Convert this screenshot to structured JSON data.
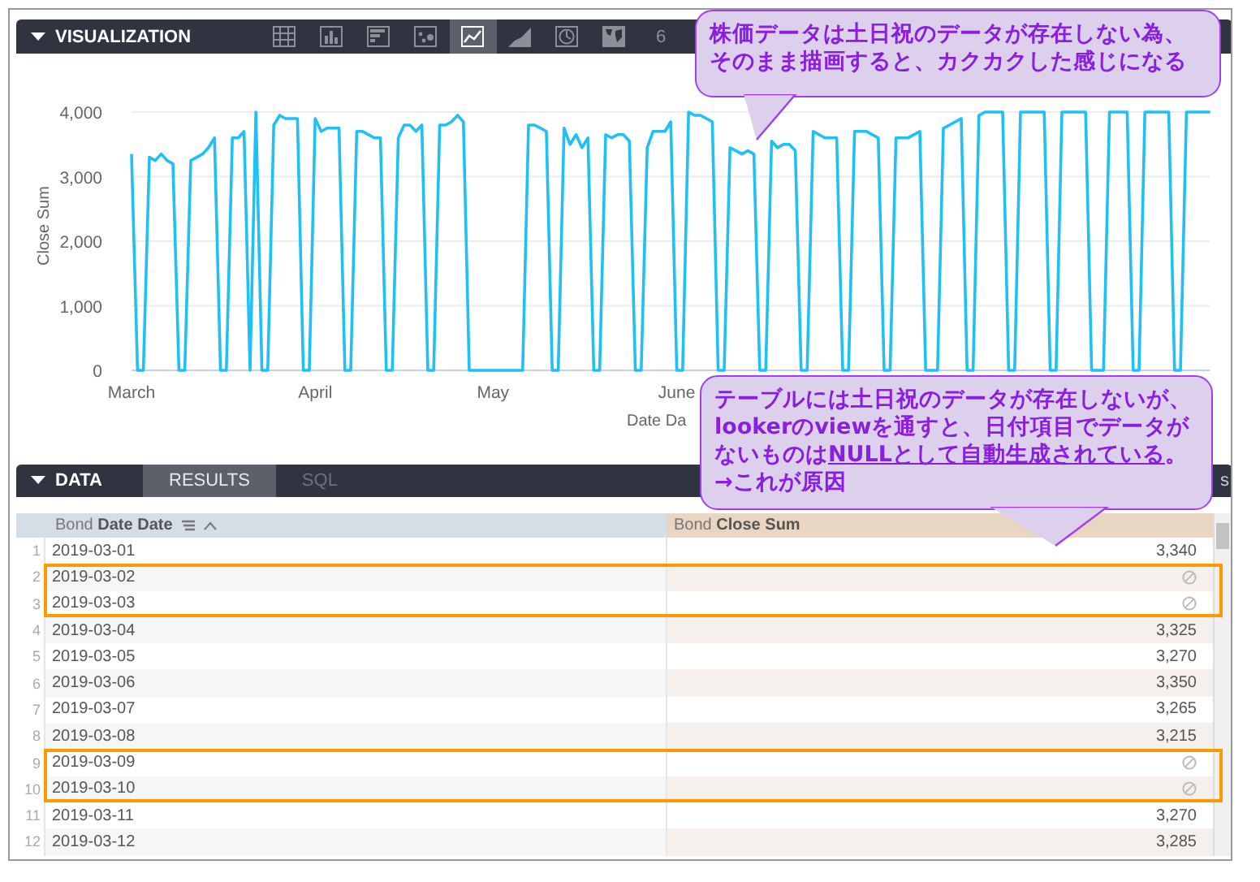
{
  "visualization": {
    "title": "VISUALIZATION",
    "tools": [
      {
        "kind": "table",
        "selected": false
      },
      {
        "kind": "column",
        "selected": false
      },
      {
        "kind": "bar",
        "selected": false
      },
      {
        "kind": "scatter",
        "selected": false
      },
      {
        "kind": "line",
        "selected": true
      },
      {
        "kind": "area",
        "selected": false
      },
      {
        "kind": "pie",
        "selected": false
      },
      {
        "kind": "map",
        "selected": false
      },
      {
        "kind": "single",
        "label": "6",
        "selected": false
      }
    ],
    "chart_data": {
      "type": "line",
      "xlabel": "Date Da",
      "ylabel": "Close Sum",
      "ylim": [
        0,
        4000
      ],
      "grid": true,
      "categories": [
        "March",
        null,
        null,
        null,
        null,
        null,
        null,
        null,
        null,
        null,
        null,
        null,
        null,
        null,
        null,
        null,
        null,
        null,
        null,
        null,
        null,
        null,
        null,
        null,
        null,
        null,
        null,
        null,
        null,
        null,
        null,
        "April",
        null,
        null,
        null,
        null,
        null,
        null,
        null,
        null,
        null,
        null,
        null,
        null,
        null,
        null,
        null,
        null,
        null,
        null,
        null,
        null,
        null,
        null,
        null,
        null,
        null,
        null,
        null,
        null,
        null,
        "May",
        null,
        null,
        null,
        null,
        null,
        null,
        null,
        null,
        null,
        null,
        null,
        null,
        null,
        null,
        null,
        null,
        null,
        null,
        null,
        null,
        null,
        null,
        null,
        null,
        null,
        null,
        null,
        null,
        null,
        null,
        "June",
        null,
        null,
        null,
        null,
        null,
        null,
        null,
        null,
        null,
        null,
        null,
        null,
        null,
        null,
        null,
        null,
        null,
        null,
        null,
        null,
        null,
        null,
        null,
        null,
        null,
        null,
        null,
        null,
        null,
        null,
        null,
        null,
        null,
        null,
        null,
        null,
        null,
        null,
        null,
        null,
        null,
        null,
        null,
        null,
        null,
        null,
        null,
        null,
        null,
        null,
        null,
        null,
        null,
        null,
        null,
        null,
        null,
        null,
        null,
        null,
        null,
        null,
        null,
        null,
        null,
        null,
        null,
        null,
        null,
        null,
        null,
        null,
        null,
        null,
        null,
        null,
        null,
        null,
        null,
        null,
        null,
        null,
        null,
        null,
        null,
        null,
        null,
        null,
        null,
        null
      ],
      "yticks": [
        {
          "value": 0,
          "label": "0"
        },
        {
          "value": 1000,
          "label": "1,000"
        },
        {
          "value": 2000,
          "label": "2,000"
        },
        {
          "value": 3000,
          "label": "3,000"
        },
        {
          "value": 4000,
          "label": "4,000"
        }
      ],
      "series": [
        {
          "color": "#1ec0f5",
          "values": [
            3350,
            0,
            0,
            3300,
            3250,
            3350,
            3250,
            3200,
            0,
            0,
            3250,
            3300,
            3350,
            3450,
            3600,
            0,
            0,
            3600,
            3600,
            3700,
            0,
            4000,
            0,
            0,
            3800,
            3950,
            3900,
            3900,
            3900,
            0,
            0,
            3900,
            3700,
            3750,
            3750,
            3750,
            0,
            0,
            3700,
            3700,
            3650,
            3600,
            3600,
            0,
            0,
            3600,
            3800,
            3800,
            3700,
            3800,
            0,
            0,
            3800,
            3800,
            3850,
            3950,
            3850,
            0,
            0,
            0,
            0,
            0,
            0,
            0,
            0,
            0,
            0,
            3800,
            3800,
            3750,
            3700,
            0,
            0,
            3750,
            3500,
            3650,
            3450,
            3600,
            0,
            0,
            3650,
            3600,
            3650,
            3650,
            3550,
            0,
            0,
            3450,
            3700,
            3700,
            3700,
            3850,
            0,
            0,
            4000,
            3950,
            3950,
            3900,
            3850,
            0,
            0,
            3450,
            3400,
            3350,
            3400,
            3350,
            0,
            0,
            3550,
            3450,
            3500,
            3500,
            3400,
            0,
            0,
            3700,
            3650,
            3600,
            3600,
            3600,
            0,
            0,
            3700,
            3700,
            3700,
            3650,
            3600,
            0,
            0,
            3600,
            3600,
            3600,
            3650,
            3700,
            0,
            0,
            0,
            3750,
            3800,
            3850,
            3900,
            0,
            0,
            3950,
            4000,
            4000,
            4000,
            4000,
            0,
            0,
            4000,
            4000,
            4000,
            4000,
            4000,
            0,
            0,
            4000,
            4000,
            4000,
            4000,
            4000,
            0,
            0,
            0,
            4000,
            4000,
            4000,
            4000,
            0,
            0,
            4000,
            4000,
            4000,
            4000,
            4000,
            0,
            0,
            4000,
            4000,
            4000,
            4000,
            4000
          ]
        }
      ]
    }
  },
  "data_panel": {
    "title": "DATA",
    "tabs": [
      {
        "label": "RESULTS",
        "selected": true
      },
      {
        "label": "SQL",
        "selected": false
      }
    ],
    "trailing_text": "s",
    "table": {
      "columns": [
        {
          "label": "Bond **Date Date**",
          "sorted": true
        },
        {
          "label": "Bond **Close Sum**",
          "sorted": false
        }
      ],
      "rows": [
        {
          "num": "1",
          "date": "2019-03-01",
          "kind": "value",
          "close": "3,340",
          "highlighted": false
        },
        {
          "num": "2",
          "date": "2019-03-02",
          "kind": "null",
          "highlighted": true
        },
        {
          "num": "3",
          "date": "2019-03-03",
          "kind": "null",
          "highlighted": true
        },
        {
          "num": "4",
          "date": "2019-03-04",
          "kind": "value",
          "close": "3,325",
          "highlighted": false
        },
        {
          "num": "5",
          "date": "2019-03-05",
          "kind": "value",
          "close": "3,270",
          "highlighted": false
        },
        {
          "num": "6",
          "date": "2019-03-06",
          "kind": "value",
          "close": "3,350",
          "highlighted": false
        },
        {
          "num": "7",
          "date": "2019-03-07",
          "kind": "value",
          "close": "3,265",
          "highlighted": false
        },
        {
          "num": "8",
          "date": "2019-03-08",
          "kind": "value",
          "close": "3,215",
          "highlighted": false
        },
        {
          "num": "9",
          "date": "2019-03-09",
          "kind": "null",
          "highlighted": true
        },
        {
          "num": "10",
          "date": "2019-03-10",
          "kind": "null",
          "highlighted": true
        },
        {
          "num": "11",
          "date": "2019-03-11",
          "kind": "value",
          "close": "3,270",
          "highlighted": false
        },
        {
          "num": "12",
          "date": "2019-03-12",
          "kind": "value",
          "close": "3,285",
          "highlighted": false
        }
      ]
    }
  },
  "callouts": [
    {
      "lines": [
        [
          {
            "text": "株価データは土日祝のデータが存在しない為、",
            "underline": false
          }
        ],
        [
          {
            "text": "そのまま描画すると、カクカクした感じになる",
            "underline": false
          }
        ]
      ]
    },
    {
      "lines": [
        [
          {
            "text": "テーブルには土日祝のデータが存在しないが、",
            "underline": false
          }
        ],
        [
          {
            "text": "lookerのviewを通すと、日付項目でデータが",
            "underline": false
          }
        ],
        [
          {
            "text": "ないものは",
            "underline": false
          },
          {
            "text": "NULLとして自動生成されている",
            "underline": true
          },
          {
            "text": "。",
            "underline": false
          }
        ],
        [
          {
            "text": "→これが原因",
            "underline": false
          }
        ]
      ]
    }
  ]
}
